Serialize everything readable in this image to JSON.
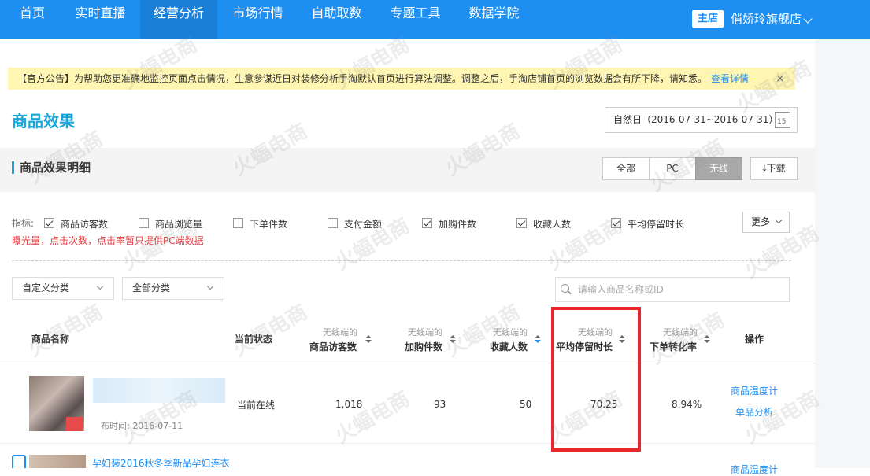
{
  "nav": {
    "items": [
      "首页",
      "实时直播",
      "经营分析",
      "市场行情",
      "自助取数",
      "专题工具",
      "数据学院"
    ],
    "active_index": 2,
    "store_badge": "主店",
    "store_name": "俏娇玲旗舰店"
  },
  "notice": {
    "text": "【官方公告】为帮助您更准确地监控页面点击情况，生意参谋近日对装修分析手淘默认首页进行算法调整。调整之后，手淘店铺首页的浏览数据会有所下降，请知悉。",
    "link": "查看详情",
    "close": "×"
  },
  "page": {
    "title": "商品效果",
    "date_range": "自然日（2016-07-31~2016-07-31）",
    "calendar_day": "15"
  },
  "section": {
    "title": "商品效果明细",
    "segments": [
      "全部",
      "PC",
      "无线"
    ],
    "active_segment": 2,
    "download": "下载"
  },
  "metrics": {
    "label": "指标:",
    "items": [
      {
        "label": "商品访客数",
        "checked": true
      },
      {
        "label": "商品浏览量",
        "checked": false
      },
      {
        "label": "下单件数",
        "checked": false
      },
      {
        "label": "支付金额",
        "checked": false
      },
      {
        "label": "加购件数",
        "checked": true
      },
      {
        "label": "收藏人数",
        "checked": true
      },
      {
        "label": "平均停留时长",
        "checked": true
      }
    ],
    "more": "更多",
    "warning": "曝光量，点击次数，点击率暂只提供PC端数据"
  },
  "filters": {
    "custom_category": "自定义分类",
    "all_category": "全部分类",
    "search_placeholder": "请输入商品名称或ID"
  },
  "table": {
    "headers": {
      "name": "商品名称",
      "status": "当前状态",
      "visitors_sub": "无线端的",
      "visitors": "商品访客数",
      "cart_sub": "无线端的",
      "cart": "加购件数",
      "fav_sub": "无线端的",
      "fav": "收藏人数",
      "stay_sub": "无线端的",
      "stay": "平均停留时长",
      "conv_sub": "无线端的",
      "conv": "下单转化率",
      "ops": "操作"
    },
    "rows": [
      {
        "publish_time": "布时间: 2016-07-11",
        "status": "当前在线",
        "visitors": "1,018",
        "cart": "93",
        "fav": "50",
        "stay": "70.25",
        "conv": "8.94%",
        "op1": "商品温度计",
        "op2": "单品分析"
      },
      {
        "title": "孕妇装2016秋冬季新品孕妇连衣",
        "op1": "商品温度计"
      }
    ]
  },
  "watermark": "火蝠电商",
  "colors": {
    "nav_bg": "#1f8ef1",
    "accent": "#1aa5d8",
    "highlight_box": "#e8272b",
    "notice_bg": "#fff6b3"
  }
}
